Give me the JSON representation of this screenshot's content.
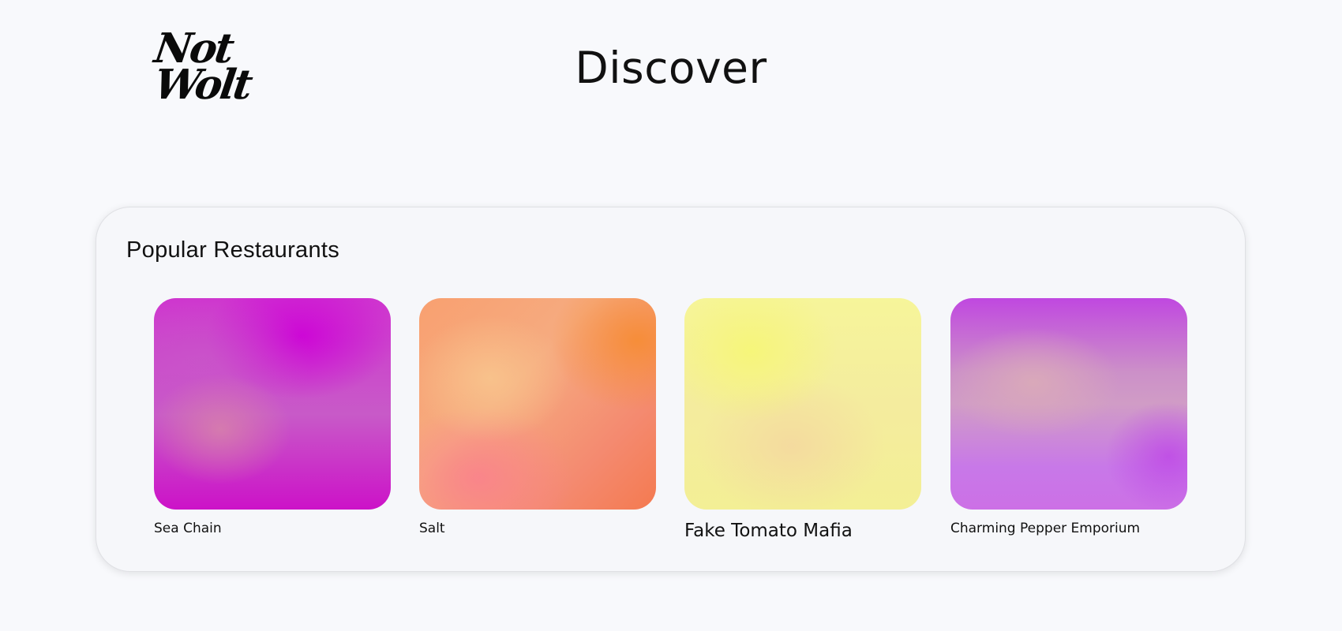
{
  "header": {
    "logo_line1": "Not",
    "logo_line2": "Wolt",
    "title": "Discover"
  },
  "popular": {
    "title": "Popular Restaurants",
    "restaurants": [
      {
        "name": "Sea Chain",
        "colors": [
          "#cc00d8",
          "#d782aa",
          "#c85ac8"
        ]
      },
      {
        "name": "Salt",
        "colors": [
          "#f68c32",
          "#f8c38c",
          "#f4827e"
        ]
      },
      {
        "name": "Fake Tomato Mafia",
        "colors": [
          "#f6f678",
          "#f4d6a0",
          "#f3ef95"
        ]
      },
      {
        "name": "Charming Pepper Emporium",
        "colors": [
          "#c048e0",
          "#daaab9",
          "#cc70e6"
        ]
      }
    ]
  }
}
